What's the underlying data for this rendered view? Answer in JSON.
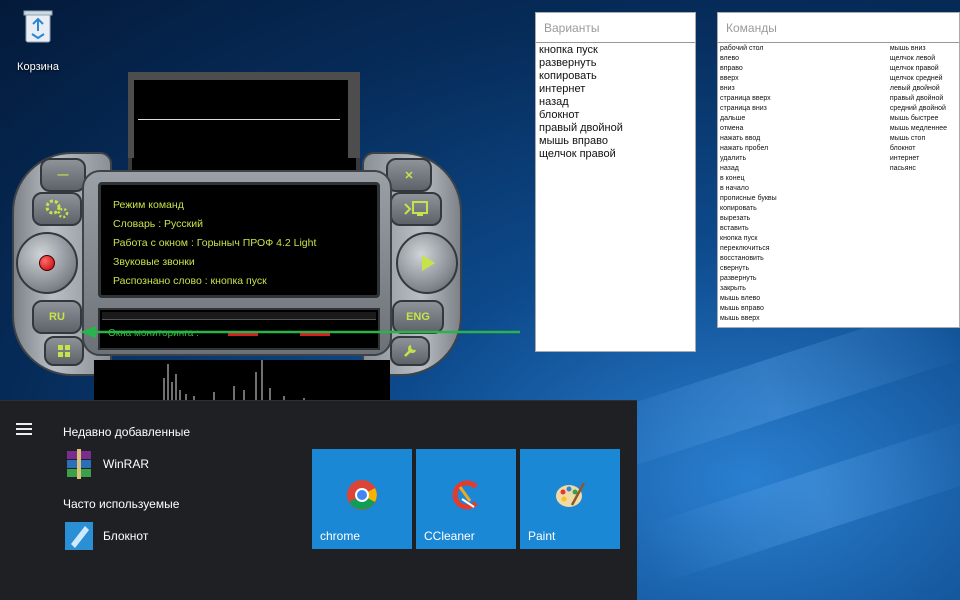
{
  "desktop": {
    "recycle_bin_label": "Корзина"
  },
  "gorynych": {
    "display_lines": [
      "Режим команд",
      "Словарь : Русский",
      "Работа с окном : Горыныч ПРОФ 4.2 Light",
      "Звуковые звонки",
      "Распознано слово : кнопка пуск"
    ],
    "monitor_label": "Окна мониторинга :",
    "buttons": {
      "minus": "—",
      "close": "✕",
      "ru": "RU",
      "eng": "ENG",
      "settings_icon": "gears-icon",
      "record_icon": "record-icon",
      "play_icon": "play-icon",
      "screen_icon": "screen-icon",
      "grid_icon": "grid-icon",
      "wrench_icon": "wrench-icon"
    },
    "accent": "#c8e24a",
    "arrow_color": "#29b34a"
  },
  "variants_panel": {
    "title": "Варианты",
    "items": [
      "кнопка пуск",
      "развернуть",
      "копировать",
      "интернет",
      "назад",
      "блокнот",
      "правый двойной",
      "мышь вправо",
      "щелчок правой"
    ]
  },
  "commands_panel": {
    "title": "Команды",
    "col1": [
      "рабочий стол",
      "влево",
      "вправо",
      "вверх",
      "вниз",
      "страница вверх",
      "страница вниз",
      "дальше",
      "отмена",
      "нажать ввод",
      "нажать пробел",
      "удалить",
      "назад",
      "в конец",
      "в начало",
      "прописные буквы",
      "копировать",
      "вырезать",
      "вставить",
      "кнопка пуск",
      "переключиться",
      "восстановить",
      "свернуть",
      "развернуть",
      "закрыть",
      "мышь влево",
      "мышь вправо",
      "мышь вверх"
    ],
    "col2": [
      "мышь вниз",
      "щелчок левой",
      "щелчок правой",
      "щелчок средней",
      "левый двойной",
      "правый двойной",
      "средний двойной",
      "мышь быстрее",
      "мышь медленнее",
      "мышь стоп",
      "блокнот",
      "интернет",
      "пасьянс"
    ]
  },
  "start_menu": {
    "recent_title": "Недавно добавленные",
    "recent_apps": [
      {
        "name": "WinRAR",
        "icon": "winrar-icon"
      }
    ],
    "frequent_title": "Часто используемые",
    "frequent_apps": [
      {
        "name": "Блокнот",
        "icon": "notepad-icon"
      }
    ],
    "tiles": [
      {
        "name": "chrome",
        "icon": "chrome-icon"
      },
      {
        "name": "CCleaner",
        "icon": "ccleaner-icon"
      },
      {
        "name": "Paint",
        "icon": "paint-icon"
      }
    ],
    "tile_color": "#1b88d5"
  }
}
